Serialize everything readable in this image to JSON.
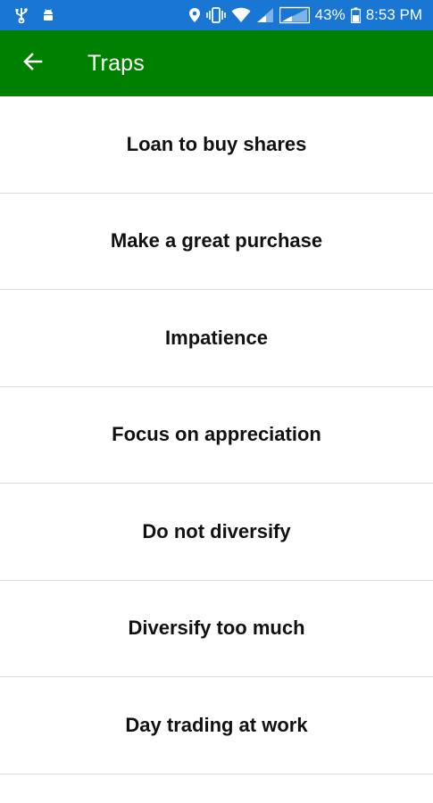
{
  "status_bar": {
    "battery": "43%",
    "time": "8:53 PM"
  },
  "app_bar": {
    "title": "Traps",
    "back_icon": "arrow-back-icon"
  },
  "list": {
    "items": [
      {
        "label": "Loan to buy shares"
      },
      {
        "label": "Make a great purchase"
      },
      {
        "label": "Impatience"
      },
      {
        "label": "Focus on appreciation"
      },
      {
        "label": "Do not diversify"
      },
      {
        "label": "Diversify too much"
      },
      {
        "label": "Day trading at work"
      }
    ]
  },
  "colors": {
    "status_bar": "#1976d2",
    "app_bar": "#008000",
    "divider": "#d8dce2"
  }
}
